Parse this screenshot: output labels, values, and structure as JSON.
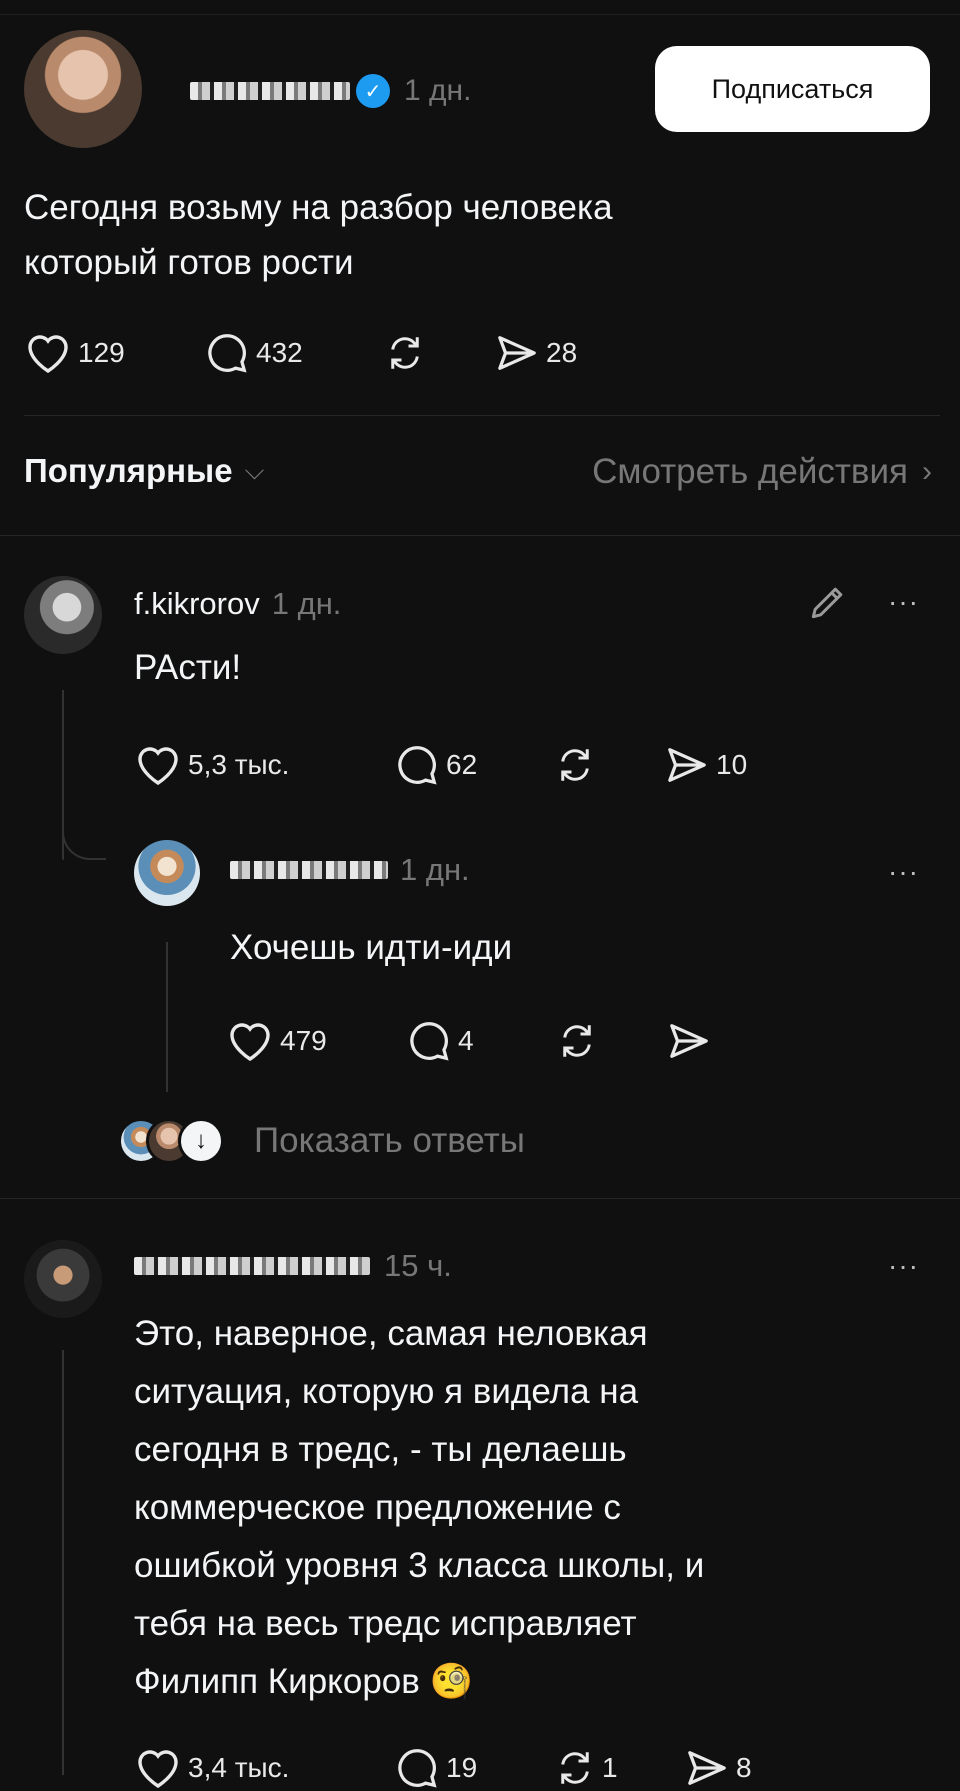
{
  "post": {
    "username_blurred": true,
    "time": "1 дн.",
    "follow_label": "Подписаться",
    "text_line1": "Сегодня возьму на разбор человека",
    "text_line2": "который готов рости",
    "likes": "129",
    "replies": "432",
    "shares": "28"
  },
  "sort": {
    "label": "Популярные",
    "activity_label": "Смотреть действия"
  },
  "comment1": {
    "username": "f.kikrorov",
    "time": "1 дн.",
    "text": "РАсти!",
    "likes": "5,3 тыс.",
    "replies": "62",
    "shares": "10"
  },
  "reply1": {
    "time": "1 дн.",
    "text": "Хочешь идти-иди",
    "likes": "479",
    "replies": "4"
  },
  "show_replies_label": "Показать ответы",
  "comment2": {
    "time": "15 ч.",
    "lines": [
      "Это, наверное, самая неловкая",
      "ситуация, которую я видела на",
      "сегодня в тредс, - ты делаешь",
      "коммерческое предложение с",
      "ошибкой уровня 3 класса школы, и",
      "тебя на весь тредс исправляет",
      "Филипп Киркоров 🧐"
    ],
    "likes": "3,4 тыс.",
    "replies": "19",
    "reposts": "1",
    "shares": "8"
  },
  "icons": {
    "verified": "verified-icon",
    "like": "heart-icon",
    "reply": "comment-icon",
    "repost": "repost-icon",
    "share": "send-icon",
    "edit": "pencil-icon",
    "more": "more-icon"
  }
}
